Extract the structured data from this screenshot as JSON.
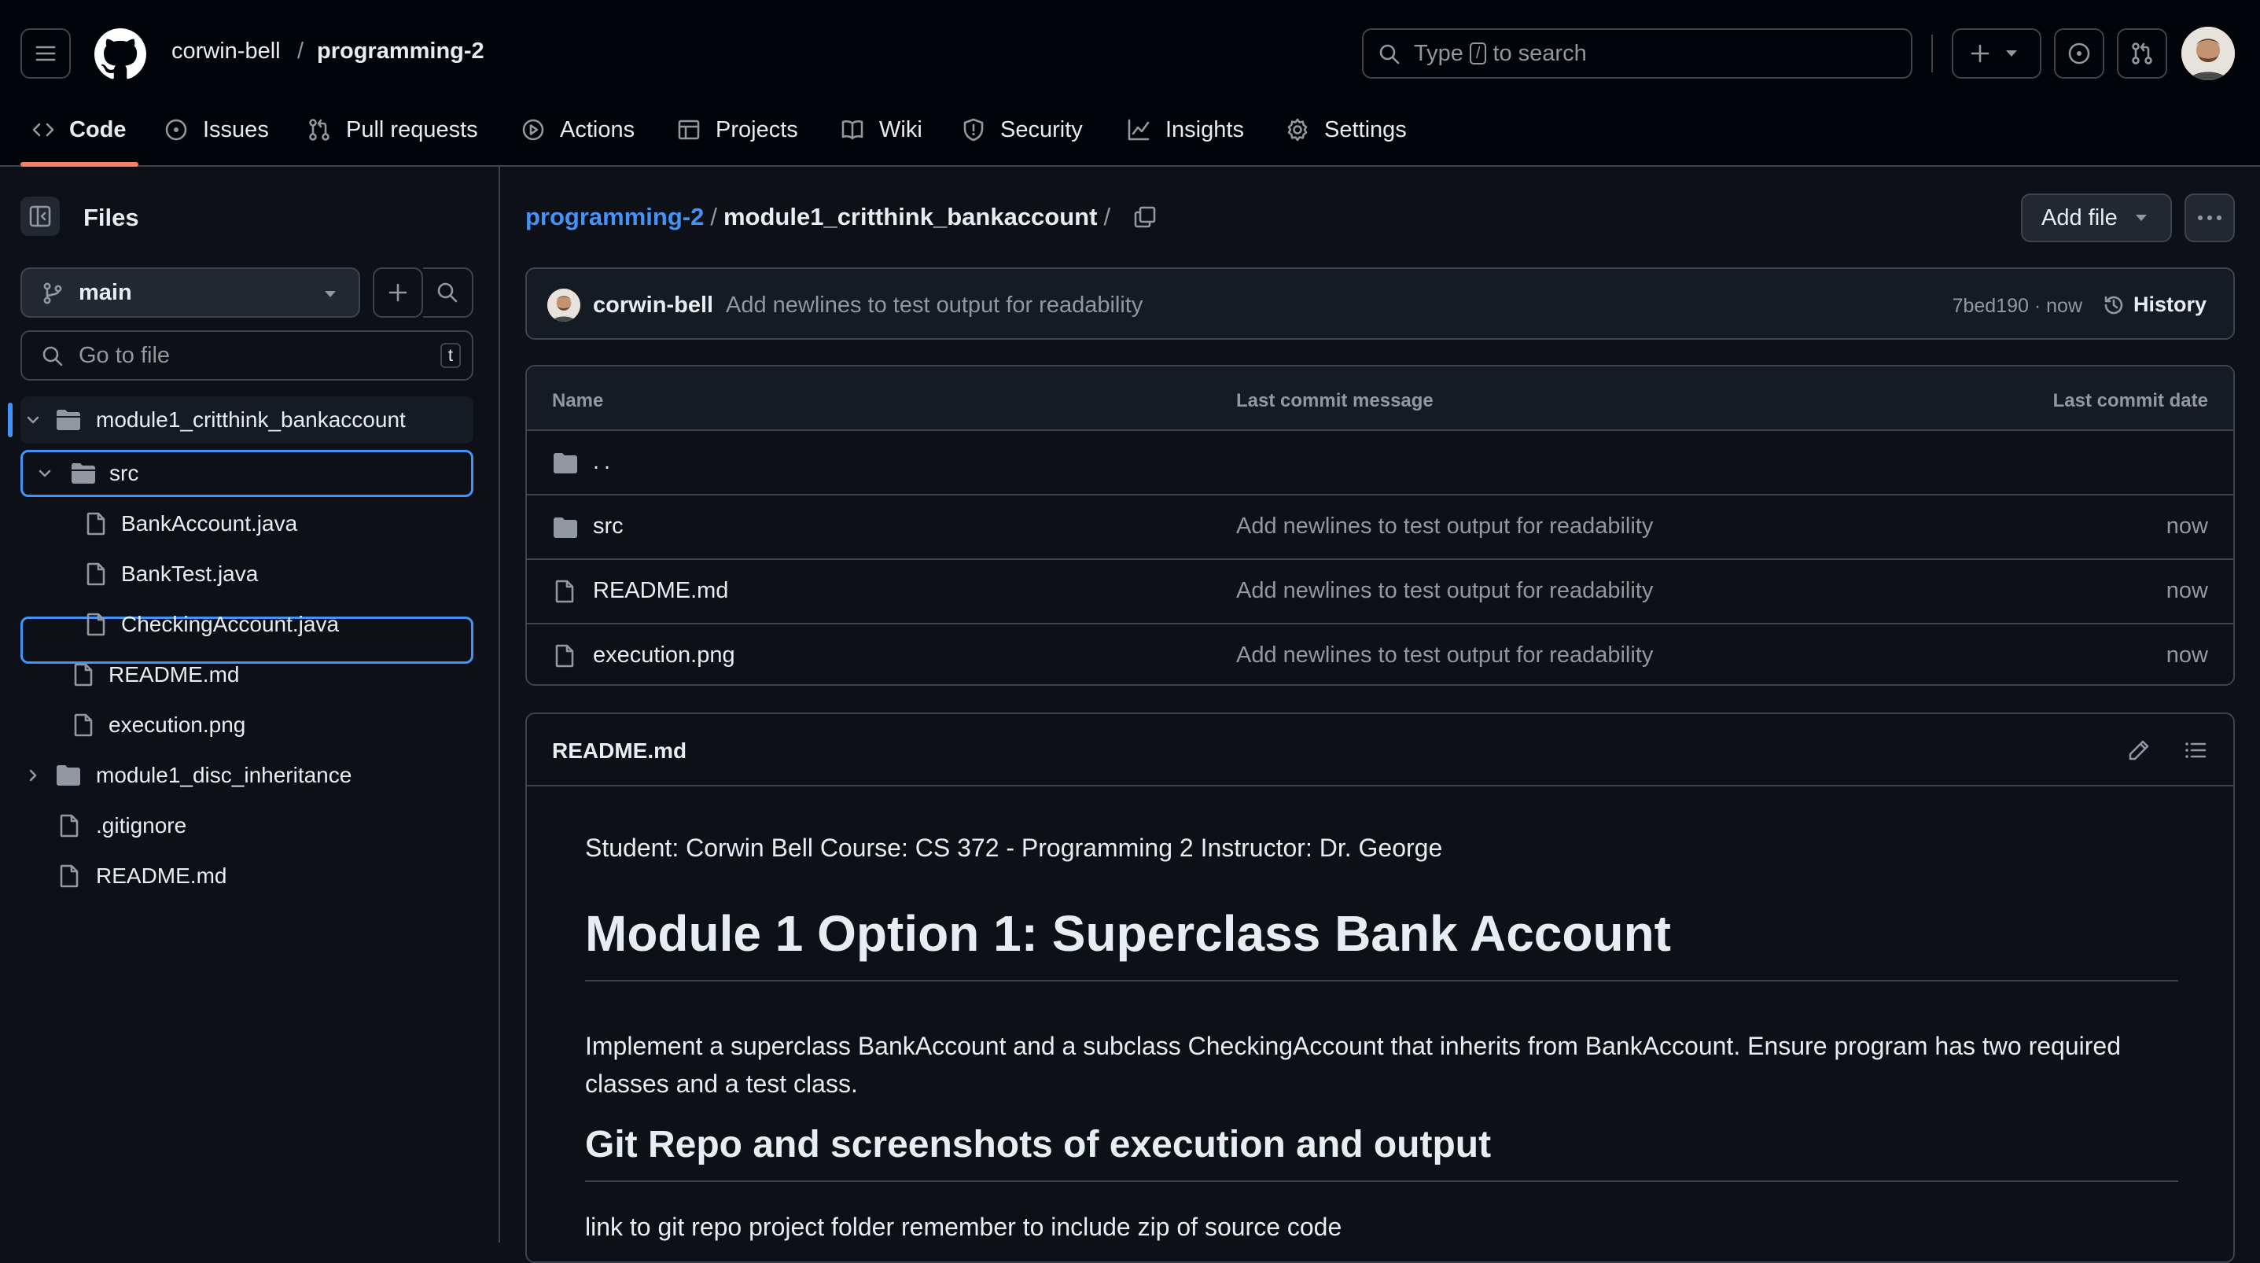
{
  "header": {
    "owner": "corwin-bell",
    "separator": "/",
    "repo": "programming-2",
    "search_prefix": "Type",
    "search_key": "/",
    "search_suffix": "to search"
  },
  "nav": {
    "tabs": [
      {
        "label": "Code",
        "icon": "code-icon",
        "active": true
      },
      {
        "label": "Issues",
        "icon": "issue-icon"
      },
      {
        "label": "Pull requests",
        "icon": "pull-request-icon"
      },
      {
        "label": "Actions",
        "icon": "play-icon"
      },
      {
        "label": "Projects",
        "icon": "table-icon"
      },
      {
        "label": "Wiki",
        "icon": "book-icon"
      },
      {
        "label": "Security",
        "icon": "shield-icon"
      },
      {
        "label": "Insights",
        "icon": "graph-icon"
      },
      {
        "label": "Settings",
        "icon": "gear-icon"
      }
    ]
  },
  "sidebar": {
    "title": "Files",
    "branch": "main",
    "goto_placeholder": "Go to file",
    "goto_key": "t",
    "tree": [
      {
        "label": "module1_critthink_bankaccount",
        "type": "folder",
        "expanded": true
      },
      {
        "label": "src",
        "type": "folder",
        "expanded": true,
        "selected": true
      },
      {
        "label": "BankAccount.java",
        "type": "file"
      },
      {
        "label": "BankTest.java",
        "type": "file"
      },
      {
        "label": "CheckingAccount.java",
        "type": "file"
      },
      {
        "label": "README.md",
        "type": "file"
      },
      {
        "label": "execution.png",
        "type": "file"
      },
      {
        "label": "module1_disc_inheritance",
        "type": "folder",
        "expanded": false
      },
      {
        "label": ".gitignore",
        "type": "file"
      },
      {
        "label": "README.md",
        "type": "file"
      }
    ]
  },
  "main": {
    "breadcrumb": {
      "repo": "programming-2",
      "sep1": "/",
      "dir": "module1_critthink_bankaccount",
      "sep2": "/"
    },
    "add_file_label": "Add file",
    "commit": {
      "author": "corwin-bell",
      "message": "Add newlines to test output for readability",
      "hash_time": "7bed190 · now",
      "history_label": "History"
    },
    "table": {
      "headers": {
        "name": "Name",
        "message": "Last commit message",
        "date": "Last commit date"
      },
      "parent": "..",
      "rows": [
        {
          "name": "src",
          "type": "folder",
          "message": "Add newlines to test output for readability",
          "date": "now"
        },
        {
          "name": "README.md",
          "type": "file",
          "message": "Add newlines to test output for readability",
          "date": "now"
        },
        {
          "name": "execution.png",
          "type": "file",
          "message": "Add newlines to test output for readability",
          "date": "now"
        }
      ]
    },
    "readme": {
      "title": "README.md",
      "meta": "Student: Corwin Bell Course: CS 372 - Programming 2 Instructor: Dr. George",
      "h1": "Module 1 Option 1: Superclass Bank Account",
      "paragraph": "Implement a superclass BankAccount and a subclass CheckingAccount that inherits from BankAccount. Ensure program has two required classes and a test class.",
      "h2": "Git Repo and screenshots of execution and output",
      "link_text": "link to git repo project folder remember to include zip of source code"
    }
  },
  "colors": {
    "accent": "#4493f8",
    "nav_underline": "#f78166",
    "bg": "#0d1117",
    "header_bg": "#010409"
  }
}
